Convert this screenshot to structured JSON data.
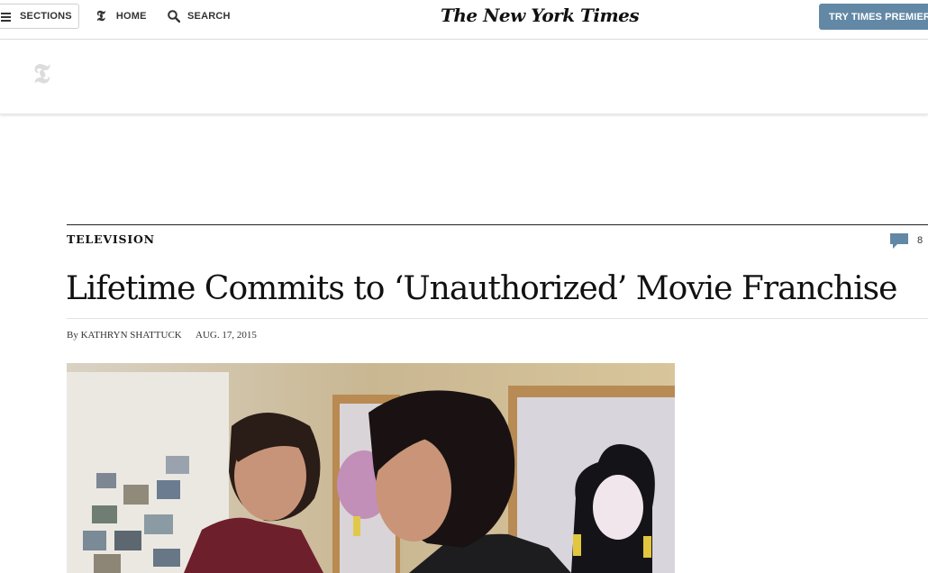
{
  "topbar": {
    "sections_label": "SECTIONS",
    "home_label": "HOME",
    "search_label": "SEARCH",
    "logo_text": "The New York Times",
    "premier_label": "TRY TIMES PREMIER",
    "premier_color": "#6288a5"
  },
  "banner": {
    "logo_glyph": "T"
  },
  "article": {
    "kicker": "TELEVISION",
    "comment_count": "8",
    "headline": "Lifetime Commits to ‘Unauthorized’ Movie Franchise",
    "byline_prefix": "By",
    "author": "KATHRYN SHATTUCK",
    "date": "AUG. 17, 2015",
    "photo_icon": "lead-photo"
  }
}
